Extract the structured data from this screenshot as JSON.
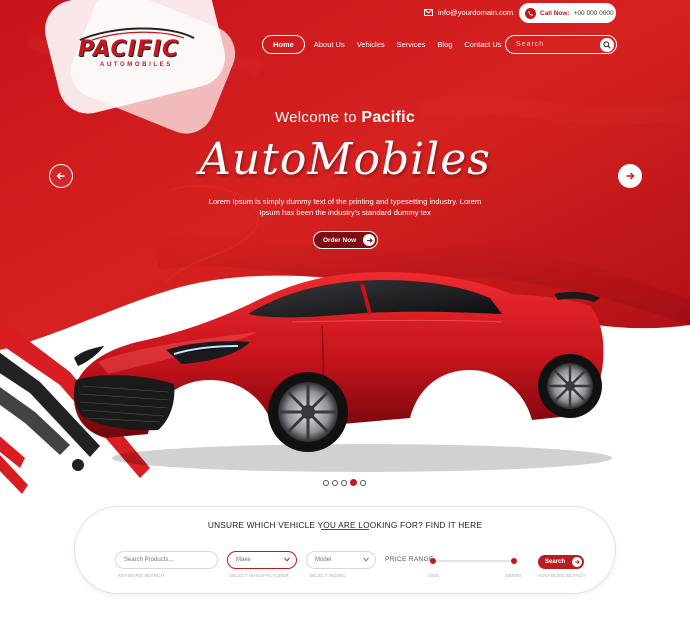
{
  "brand": {
    "name": "PACIFIC",
    "tagline": "AUTOMOBILES"
  },
  "topbar": {
    "email": "info@yourdomain.com",
    "call_label": "Call Now:",
    "phone": "+00 000 0000"
  },
  "nav": {
    "items": [
      {
        "label": "Home",
        "active": true
      },
      {
        "label": "About Us"
      },
      {
        "label": "Vehicles"
      },
      {
        "label": "Services"
      },
      {
        "label": "Blog"
      },
      {
        "label": "Contact Us"
      }
    ],
    "search_placeholder": "Search"
  },
  "hero": {
    "welcome_prefix": "Welcome to",
    "welcome_brand": "Pacific",
    "script_title": "AutoMobiles",
    "description": "Lorem Ipsum is simply dummy text of the printing and typesetting industry. Lorem Ipsum has been the industry's standard dummy tex",
    "cta_label": "Order Now",
    "slides_total": 5,
    "slide_active": 4
  },
  "finder": {
    "title": "UNSURE WHICH VEHICLE YOU ARE LOOKING FOR? FIND IT HERE",
    "keyword_placeholder": "Search Products...",
    "keyword_caption": "KEYWORD SEARCH",
    "make_value": "Make",
    "make_caption": "SELECT MANUFACTURER",
    "model_value": "Model",
    "model_caption": "SELECT MODEL",
    "price_label": "PRICE RANGE",
    "price_min": "2000",
    "price_max": "100000",
    "search_label": "Search",
    "search_caption": "ADVANCED SEARCH"
  },
  "colors": {
    "accent": "#c21820",
    "accent_dark": "#7d0d13",
    "hero_bg": "#d21e1e"
  }
}
